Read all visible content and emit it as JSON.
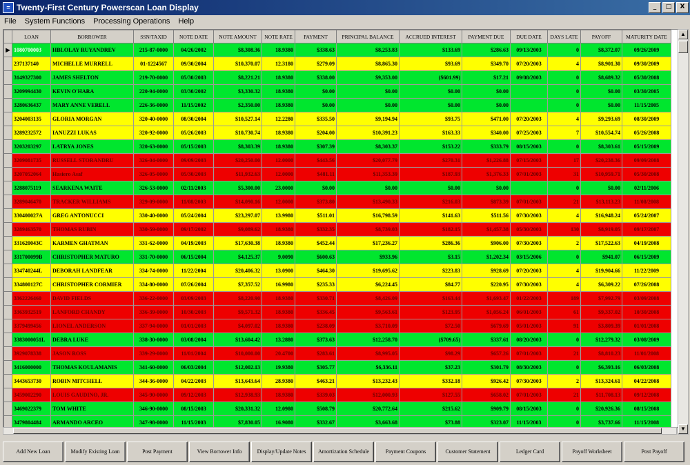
{
  "window": {
    "title": "Twenty-First Century Powerscan Loan Display",
    "minimize": "_",
    "maximize": "□",
    "close": "X"
  },
  "menu": [
    "File",
    "System Functions",
    "Processing Operations",
    "Help"
  ],
  "columns": [
    "LOAN",
    "BORROWER",
    "SSN/TAXID",
    "NOTE DATE",
    "NOTE AMOUNT",
    "NOTE RATE",
    "PAYMENT",
    "PRINCIPAL BALANCE",
    "ACCRUED INTEREST",
    "PAYMENT DUE",
    "DUE DATE",
    "DAYS LATE",
    "PAYOFF",
    "MATURITY DATE"
  ],
  "colors": {
    "green": "#00e62e",
    "yellow": "#ffff00",
    "red": "#ee0000"
  },
  "rows": [
    {
      "status": "green",
      "selected": true,
      "cells": [
        "1080700003",
        "HBLOLAY RUYANDREV",
        "215-87-0000",
        "04/26/2002",
        "$8,308.36",
        "18.9380",
        "$338.63",
        "$8,253.83",
        "$133.69",
        "$286.63",
        "09/13/2003",
        "0",
        "$8,372.07",
        "09/26/2009"
      ]
    },
    {
      "status": "yellow",
      "cells": [
        "237137140",
        "MICHELLE MURRELL",
        "01-1224567",
        "09/30/2004",
        "$10,370.07",
        "12.3180",
        "$279.09",
        "$8,865.30",
        "$93.69",
        "$349.70",
        "07/20/2003",
        "4",
        "$8,901.30",
        "09/30/2009"
      ]
    },
    {
      "status": "green",
      "cells": [
        "3149327300",
        "JAMES SHELTON",
        "219-70-0000",
        "05/30/2003",
        "$8,221.21",
        "18.9380",
        "$338.00",
        "$9,353.00",
        "($601.99)",
        "$17.21",
        "09/08/2003",
        "0",
        "$8,689.32",
        "05/30/2008"
      ]
    },
    {
      "status": "green",
      "cells": [
        "3209994430",
        "KEVIN O'HARA",
        "220-94-0000",
        "03/30/2002",
        "$3,330.32",
        "18.9380",
        "$0.00",
        "$0.00",
        "$0.00",
        "$0.00",
        "",
        "0",
        "$0.00",
        "03/30/2005"
      ]
    },
    {
      "status": "green",
      "cells": [
        "3280636437",
        "MARY ANNE VERELL",
        "226-36-0000",
        "11/15/2002",
        "$2,350.00",
        "18.9380",
        "$0.00",
        "$0.00",
        "$0.00",
        "$0.00",
        "",
        "0",
        "$0.00",
        "11/15/2005"
      ]
    },
    {
      "status": "yellow",
      "cells": [
        "3204003135",
        "GLORIA MORGAN",
        "320-40-0000",
        "08/30/2004",
        "$10,527.14",
        "12.2280",
        "$335.50",
        "$9,194.94",
        "$93.75",
        "$471.00",
        "07/20/2003",
        "4",
        "$9,293.69",
        "08/30/2009"
      ]
    },
    {
      "status": "yellow",
      "cells": [
        "3289232572",
        "IANUZZI LUKAS",
        "320-92-0000",
        "05/26/2003",
        "$10,730.74",
        "18.9380",
        "$204.00",
        "$10,391.23",
        "$163.33",
        "$340.00",
        "07/25/2003",
        "7",
        "$10,554.74",
        "05/26/2008"
      ]
    },
    {
      "status": "green",
      "cells": [
        "3203203297",
        "LATRYA JONES",
        "320-63-0000",
        "05/15/2003",
        "$8,303.39",
        "18.9380",
        "$307.39",
        "$8,303.37",
        "$153.22",
        "$333.79",
        "08/15/2003",
        "0",
        "$8,303.61",
        "05/15/2009"
      ]
    },
    {
      "status": "red",
      "cells": [
        "3209081735",
        "RUSSELL STORANDRU",
        "326-04-0000",
        "09/09/2003",
        "$20,250.00",
        "12.0000",
        "$443.56",
        "$20,077.79",
        "$270.31",
        "$1,226.88",
        "07/15/2003",
        "17",
        "$20,238.36",
        "09/09/2008"
      ]
    },
    {
      "status": "red",
      "cells": [
        "3207052064",
        "Hasiero Asaf",
        "326-05-0000",
        "05/30/2003",
        "$11,932.63",
        "12.0000",
        "$481.11",
        "$11,353.39",
        "$187.93",
        "$1,376.33",
        "07/01/2003",
        "31",
        "$10,959.71",
        "05/30/2008"
      ]
    },
    {
      "status": "green",
      "cells": [
        "3288075119",
        "SEARKENA WAITE",
        "326-53-0000",
        "02/11/2003",
        "$5,300.00",
        "23.0000",
        "$0.00",
        "$0.00",
        "$0.00",
        "$0.00",
        "",
        "0",
        "$0.00",
        "02/11/2006"
      ]
    },
    {
      "status": "red",
      "cells": [
        "3289046470",
        "TRACKER WILLIAMS",
        "329-09-0000",
        "11/08/2003",
        "$14,090.16",
        "12.0000",
        "$373.80",
        "$13,490.33",
        "$216.03",
        "$873.39",
        "07/01/2003",
        "21",
        "$13,113.23",
        "11/08/2008"
      ]
    },
    {
      "status": "yellow",
      "cells": [
        "330400027A",
        "GREG ANTONUCCI",
        "330-40-0000",
        "05/24/2004",
        "$23,297.07",
        "13.9980",
        "$511.01",
        "$16,798.59",
        "$141.63",
        "$511.56",
        "07/30/2003",
        "4",
        "$16,948.24",
        "05/24/2007"
      ]
    },
    {
      "status": "red",
      "cells": [
        "3289463570",
        "THOMAS RUBIN",
        "330-59-0000",
        "09/17/2002",
        "$9,089.62",
        "18.9380",
        "$332.35",
        "$8,739.03",
        "$182.15",
        "$1,457.38",
        "05/30/2003",
        "130",
        "$8,919.05",
        "09/17/2007"
      ]
    },
    {
      "status": "yellow",
      "cells": [
        "331620043C",
        "KARMEN GHATMAN",
        "331-62-0000",
        "04/19/2003",
        "$17,630.38",
        "18.9380",
        "$452.44",
        "$17,236.27",
        "$286.36",
        "$906.00",
        "07/30/2003",
        "2",
        "$17,522.63",
        "04/19/2008"
      ]
    },
    {
      "status": "green",
      "cells": [
        "331700099B",
        "CHRISTOPHER MATURO",
        "331-70-0000",
        "06/15/2004",
        "$4,125.37",
        "9.0090",
        "$600.63",
        "$933.96",
        "$3.15",
        "$1,202.34",
        "03/15/2006",
        "0",
        "$941.07",
        "06/15/2009"
      ]
    },
    {
      "status": "yellow",
      "cells": [
        "334740244L",
        "DEBORAH LANDFEAR",
        "334-74-0000",
        "11/22/2004",
        "$20,406.32",
        "13.0900",
        "$464.30",
        "$19,695.62",
        "$223.83",
        "$928.69",
        "07/20/2003",
        "4",
        "$19,904.66",
        "11/22/2009"
      ]
    },
    {
      "status": "yellow",
      "cells": [
        "334800127C",
        "CHRISTOPHER CORMIER",
        "334-80-0000",
        "07/26/2004",
        "$7,357.52",
        "16.9980",
        "$235.33",
        "$6,224.45",
        "$84.77",
        "$220.95",
        "07/30/2003",
        "4",
        "$6,309.22",
        "07/26/2008"
      ]
    },
    {
      "status": "red",
      "cells": [
        "3362226460",
        "DAVID FIELDS",
        "336-22-0000",
        "03/09/2003",
        "$8,220.90",
        "18.9380",
        "$330.71",
        "$8,426.09",
        "$163.44",
        "$1,693.47",
        "01/22/2003",
        "189",
        "$7,992.79",
        "03/09/2008"
      ]
    },
    {
      "status": "red",
      "cells": [
        "3363932519",
        "LANFORD CHANDY",
        "336-39-0000",
        "10/30/2003",
        "$9,571.32",
        "18.9380",
        "$336.45",
        "$9,563.61",
        "$123.95",
        "$1,056.24",
        "06/01/2003",
        "61",
        "$9,337.02",
        "10/30/2008"
      ]
    },
    {
      "status": "red",
      "cells": [
        "3379499456",
        "LIONEL ANDERSON",
        "337-94-0000",
        "01/01/2003",
        "$4,097.02",
        "18.9380",
        "$238.09",
        "$3,710.09",
        "$72.50",
        "$679.69",
        "05/01/2003",
        "91",
        "$3,809.39",
        "01/01/2008"
      ]
    },
    {
      "status": "green",
      "cells": [
        "3383000051L",
        "DEBRA LUKE",
        "338-30-0000",
        "03/08/2004",
        "$13,604.42",
        "13.2880",
        "$373.63",
        "$12,258.70",
        "($709.65)",
        "$337.61",
        "08/20/2003",
        "0",
        "$12,279.32",
        "03/08/2009"
      ]
    },
    {
      "status": "red",
      "cells": [
        "3929078338",
        "JASON ROSS",
        "339-29-0000",
        "11/01/2004",
        "$10,000.00",
        "20.4700",
        "$283.61",
        "$8,995.05",
        "$98.29",
        "$657.26",
        "07/01/2003",
        "21",
        "$8,810.23",
        "11/01/2008"
      ]
    },
    {
      "status": "green",
      "cells": [
        "3416000000",
        "THOMAS KOULAMANIS",
        "341-60-0000",
        "06/03/2004",
        "$12,002.13",
        "19.9380",
        "$305.77",
        "$6,336.11",
        "$37.23",
        "$301.79",
        "08/30/2003",
        "0",
        "$6,393.16",
        "06/03/2008"
      ]
    },
    {
      "status": "yellow",
      "cells": [
        "3443653730",
        "ROBIN MITCHELL",
        "344-36-0000",
        "04/22/2003",
        "$13,643.64",
        "28.9380",
        "$463.21",
        "$13,232.43",
        "$332.18",
        "$926.42",
        "07/30/2003",
        "2",
        "$13,324.61",
        "04/22/2008"
      ]
    },
    {
      "status": "red",
      "cells": [
        "3459002290",
        "LOUIS GAUDINO, JR.",
        "345-90-0000",
        "09/12/2003",
        "$12,938.93",
        "18.9380",
        "$339.03",
        "$12,000.93",
        "$127.55",
        "$658.02",
        "07/01/2003",
        "21",
        "$11,708.13",
        "09/12/2008"
      ]
    },
    {
      "status": "green",
      "cells": [
        "3469022379",
        "TOM WHITE",
        "346-90-0000",
        "08/15/2003",
        "$20,331.32",
        "12.0980",
        "$508.79",
        "$20,772.64",
        "$215.62",
        "$909.79",
        "08/15/2003",
        "0",
        "$20,926.36",
        "08/15/2008"
      ]
    },
    {
      "status": "green",
      "cells": [
        "3479804484",
        "ARMANDO ARCEO",
        "347-98-0000",
        "11/15/2003",
        "$7,830.05",
        "16.9080",
        "$332.67",
        "$3,663.68",
        "$73.88",
        "$323.07",
        "11/15/2003",
        "0",
        "$3,737.66",
        "11/15/2008"
      ]
    }
  ],
  "buttons": [
    "Add New Loan",
    "Modify Existing Loan",
    "Post Payment",
    "View Borrower Info",
    "Display/Update Notes",
    "Amortization Schedule",
    "Payment Coupons",
    "Customer Statement",
    "Ledger Card",
    "Payoff Worksheet",
    "Post Payoff"
  ]
}
